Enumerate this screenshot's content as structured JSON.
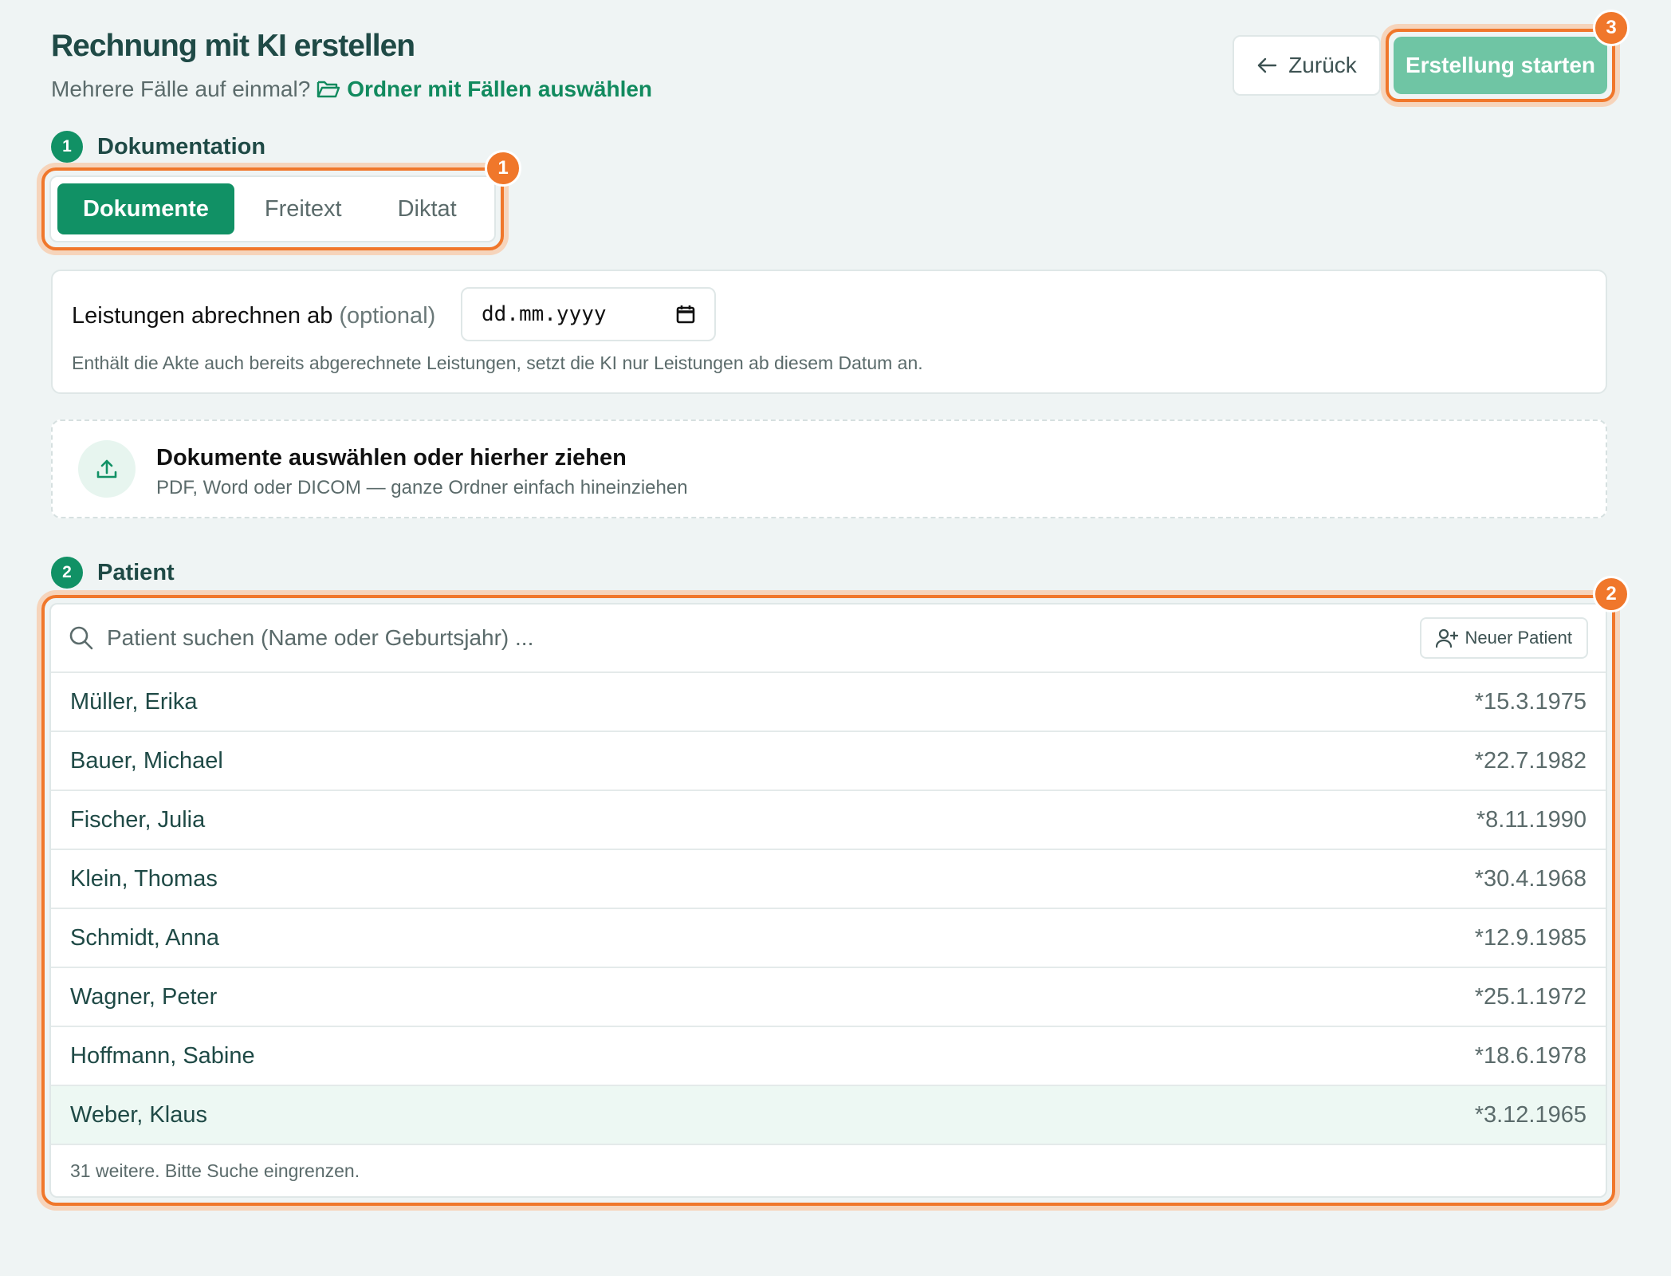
{
  "header": {
    "title": "Rechnung mit KI erstellen",
    "subtitle_prefix": "Mehrere Fälle auf einmal?",
    "folder_link": "Ordner mit Fällen auswählen",
    "back_label": "Zurück",
    "start_label": "Erstellung starten"
  },
  "badges": {
    "tabs": "1",
    "patient": "2",
    "start": "3"
  },
  "sections": {
    "documentation": {
      "step": "1",
      "title": "Dokumentation"
    },
    "patient": {
      "step": "2",
      "title": "Patient"
    }
  },
  "tabs": [
    {
      "label": "Dokumente",
      "active": true
    },
    {
      "label": "Freitext",
      "active": false
    },
    {
      "label": "Diktat",
      "active": false
    }
  ],
  "billing_date": {
    "label": "Leistungen abrechnen ab",
    "optional": "(optional)",
    "value": "dd.mm.yyyy",
    "hint": "Enthält die Akte auch bereits abgerechnete Leistungen, setzt die KI nur Leistungen ab diesem Datum an."
  },
  "upload": {
    "title": "Dokumente auswählen oder hierher ziehen",
    "subtitle": "PDF, Word oder DICOM — ganze Ordner einfach hineinziehen"
  },
  "patient_search": {
    "placeholder": "Patient suchen (Name oder Geburtsjahr) ...",
    "new_patient_label": "Neuer Patient",
    "patients": [
      {
        "name": "Müller, Erika",
        "dob": "*15.3.1975"
      },
      {
        "name": "Bauer, Michael",
        "dob": "*22.7.1982"
      },
      {
        "name": "Fischer, Julia",
        "dob": "*8.11.1990"
      },
      {
        "name": "Klein, Thomas",
        "dob": "*30.4.1968"
      },
      {
        "name": "Schmidt, Anna",
        "dob": "*12.9.1985"
      },
      {
        "name": "Wagner, Peter",
        "dob": "*25.1.1972"
      },
      {
        "name": "Hoffmann, Sabine",
        "dob": "*18.6.1978"
      },
      {
        "name": "Weber, Klaus",
        "dob": "*3.12.1965",
        "highlighted": true
      }
    ],
    "more_text": "31 weitere. Bitte Suche eingrenzen."
  },
  "colors": {
    "accent": "#119165",
    "highlight": "#f0772b",
    "start_button": "#6fc5a4"
  },
  "icons": {
    "folder_link": "folder-open-icon",
    "back": "arrow-left-icon",
    "date": "calendar-icon",
    "upload": "upload-icon",
    "search": "search-icon",
    "new_patient": "user-plus-icon"
  }
}
